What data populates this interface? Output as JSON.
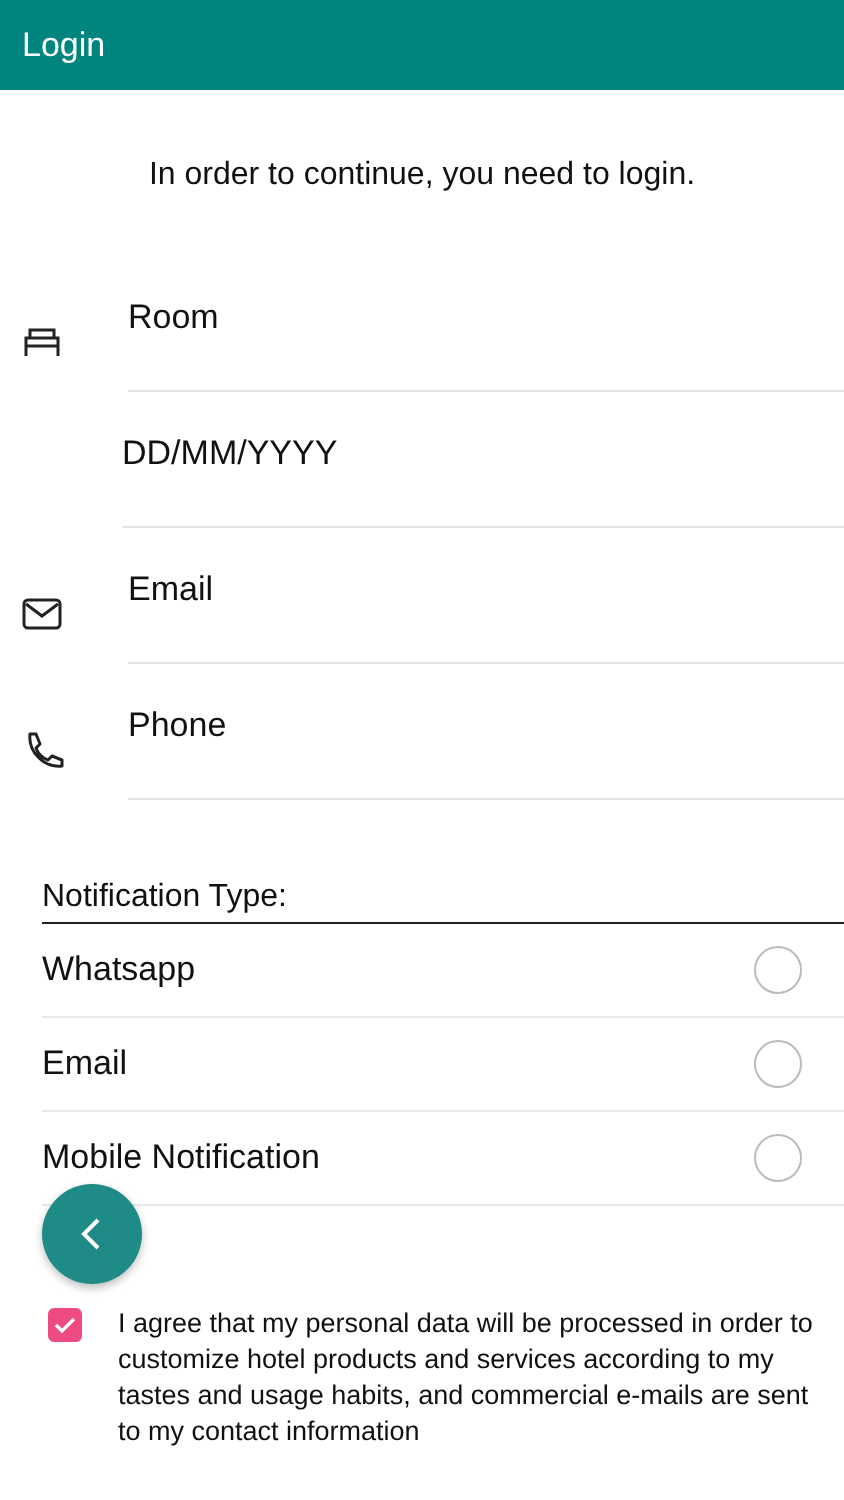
{
  "app_bar": {
    "title": "Login"
  },
  "intro": "In order to continue, you need to login.",
  "fields": [
    {
      "kind": "room",
      "placeholder": "Room"
    },
    {
      "kind": "date",
      "placeholder": "DD/MM/YYYY"
    },
    {
      "kind": "email",
      "placeholder": "Email"
    },
    {
      "kind": "phone",
      "placeholder": "Phone"
    }
  ],
  "notification_type": {
    "label": "Notification Type:",
    "options": [
      {
        "label": "Whatsapp",
        "selected": false
      },
      {
        "label": "Email",
        "selected": false
      },
      {
        "label": "Mobile Notification",
        "selected": false
      }
    ]
  },
  "consent": {
    "checked": true,
    "text": "I agree that my personal data will be processed in order to customize hotel products and services according to my tastes and usage habits, and commercial e-mails are sent to my contact information"
  }
}
